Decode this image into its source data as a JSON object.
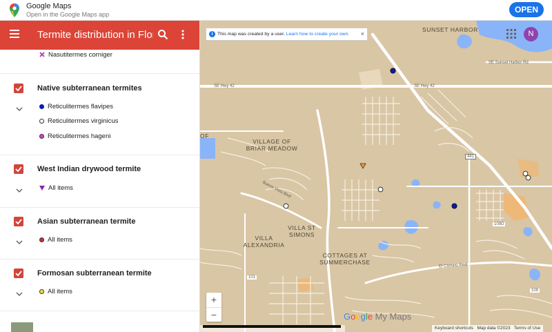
{
  "banner": {
    "app_name": "Google Maps",
    "subtitle": "Open in the Google Maps app",
    "open_label": "OPEN"
  },
  "header": {
    "title": "Termite distribution in Flor…"
  },
  "legend": {
    "top_item": "Nasutitermes corniger",
    "layers": [
      {
        "title": "Native subterranean termites",
        "items": [
          {
            "label": "Reticulitermes flavipes",
            "color": "#0d1ab0"
          },
          {
            "label": "Reticulitermes virginicus",
            "color": "#ffffff"
          },
          {
            "label": "Reticulitermes hageni",
            "color": "#e040c8"
          }
        ]
      },
      {
        "title": "West Indian drywood termite",
        "items": [
          {
            "label": "All items",
            "color": "#8e24aa"
          }
        ]
      },
      {
        "title": "Asian subterranean termite",
        "items": [
          {
            "label": "All items",
            "color": "#d32f2f"
          }
        ]
      },
      {
        "title": "Formosan subterranean termite",
        "items": [
          {
            "label": "All items",
            "color": "#f6e03a"
          }
        ]
      }
    ]
  },
  "map": {
    "notice_text": "This map was created by a user.",
    "notice_link": "Learn how to create your own.",
    "avatar_letter": "N",
    "labels": {
      "sunset_harbor": "SUNSET HARBOR",
      "village_briar": "VILLAGE OF BRIAR MEADOW",
      "villa_st_simons": "VILLA ST SIMONS",
      "villa_alexandria": "VILLA ALEXANDRIA",
      "cottages": "COTTAGES AT SUMMERCHASE",
      "of": "OF"
    },
    "roads": {
      "se_hwy_42_left": "SE Hwy 42",
      "se_hwy_42_right": "SE Hwy 42",
      "se_sunset_harbor": "SE Sunset Harbor Rd",
      "buena_vista": "Buena Vista Blvd",
      "el_camino": "El Camino Real",
      "r441": "441",
      "r109d": "109D",
      "r101": "101",
      "r109": "109"
    },
    "brand": "Google My Maps",
    "attribution": {
      "keyboard": "Keyboard shortcuts",
      "data": "Map data ©2023",
      "terms": "Terms of Use"
    },
    "zoom_in": "+",
    "zoom_out": "−"
  },
  "colors": {
    "header_red": "#db4437",
    "map_land": "#d9c6a5",
    "water": "#8ab4f8",
    "accent_blue": "#1a73e8"
  }
}
